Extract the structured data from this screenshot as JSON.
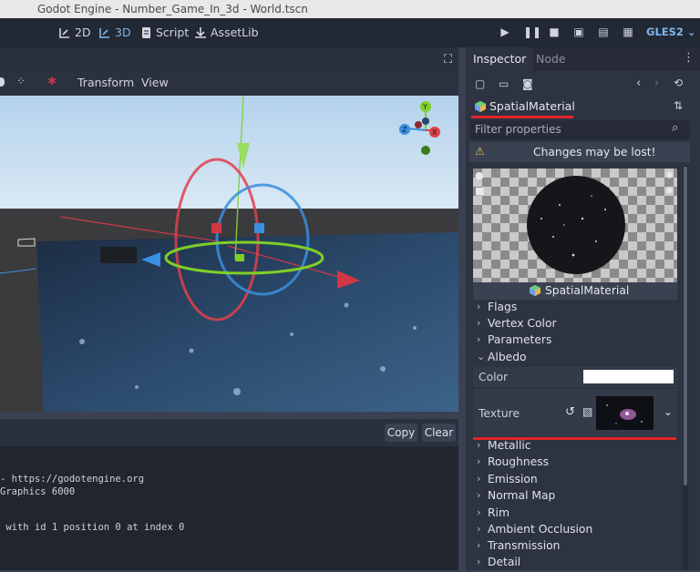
{
  "window": {
    "title": "Godot Engine - Number_Game_In_3d - World.tscn"
  },
  "topbar": {
    "items": [
      {
        "label": "2D",
        "icon": "2d-icon"
      },
      {
        "label": "3D",
        "icon": "3d-icon"
      },
      {
        "label": "Script",
        "icon": "script-icon"
      },
      {
        "label": "AssetLib",
        "icon": "assetlib-icon"
      }
    ],
    "renderer": "GLES2 ⌄"
  },
  "viewport": {
    "menu": {
      "transform": "Transform",
      "view": "View"
    }
  },
  "output": {
    "copy": "Copy",
    "clear": "Clear",
    "lines": [
      "- https://godotengine.org",
      "Graphics 6000",
      " with id 1 position 0 at index 0"
    ]
  },
  "inspector": {
    "tabs": {
      "inspector": "Inspector",
      "node": "Node"
    },
    "resource": "SpatialMaterial",
    "filter_placeholder": "Filter properties",
    "warning": "Changes may be lost!",
    "preview_label": "SpatialMaterial",
    "sections_top": [
      "Flags",
      "Vertex Color",
      "Parameters"
    ],
    "albedo": {
      "label": "Albedo",
      "color_label": "Color",
      "color_value": "#ffffff",
      "texture_label": "Texture"
    },
    "sections_bottom": [
      "Metallic",
      "Roughness",
      "Emission",
      "Normal Map",
      "Rim",
      "Ambient Occlusion",
      "Transmission",
      "Detail"
    ]
  },
  "colors": {
    "accent": "#7db8f0",
    "highlight": "#e0242a",
    "panel": "#2d3341"
  }
}
